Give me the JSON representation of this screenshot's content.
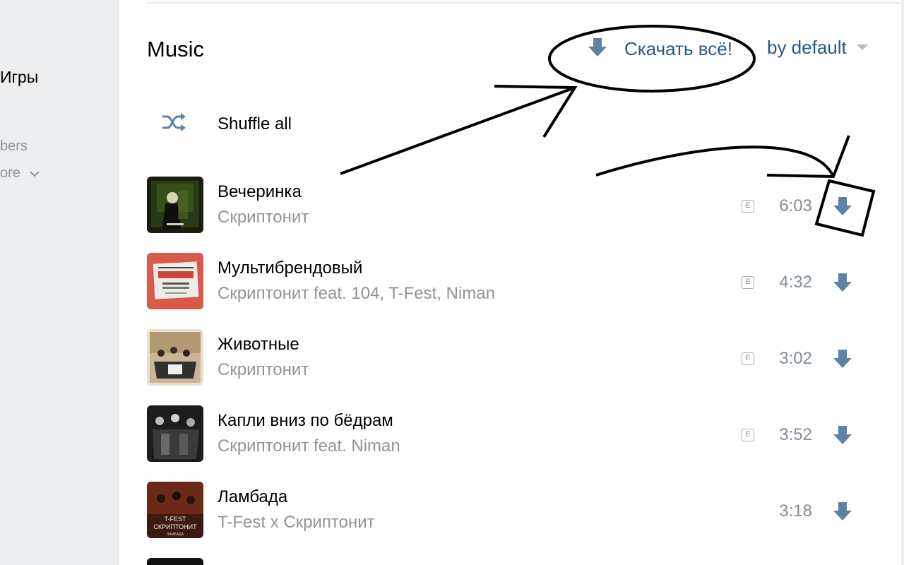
{
  "sidebar": {
    "games_label": "Игры",
    "members_label": "bers",
    "more_label": "ore"
  },
  "header": {
    "title": "Music",
    "download_all_label": "Скачать всё!",
    "sort_label": "by default"
  },
  "shuffle": {
    "label": "Shuffle all"
  },
  "tracks": [
    {
      "title": "Вечеринка",
      "artist": "Скриптонит",
      "duration": "6:03",
      "explicit": "E"
    },
    {
      "title": "Мультибрендовый",
      "artist": "Скриптонит feat. 104, T-Fest, Niman",
      "duration": "4:32",
      "explicit": "E"
    },
    {
      "title": "Животные",
      "artist": "Скриптонит",
      "duration": "3:02",
      "explicit": "E"
    },
    {
      "title": "Капли вниз по бёдрам",
      "artist": "Скриптонит feat. Niman",
      "duration": "3:52",
      "explicit": "E"
    },
    {
      "title": "Ламбада",
      "artist": "T-Fest x Скриптонит",
      "duration": "3:18"
    }
  ],
  "cover_texts": {
    "lambada_top": "T-FEST",
    "lambada_mid": "СКРИПТОНИТ",
    "lambada_bottom": "ЛАМБАДА"
  },
  "icons": {
    "download": "download-arrow-icon",
    "shuffle": "shuffle-icon",
    "sort_caret": "caret-down-icon",
    "chevron": "chevron-down-icon"
  },
  "colors": {
    "accent": "#2a5885",
    "icon_blue": "#5e81a8",
    "secondary_text": "#939393",
    "duration_text": "#818c99",
    "sidebar_bg": "#edeef0"
  }
}
